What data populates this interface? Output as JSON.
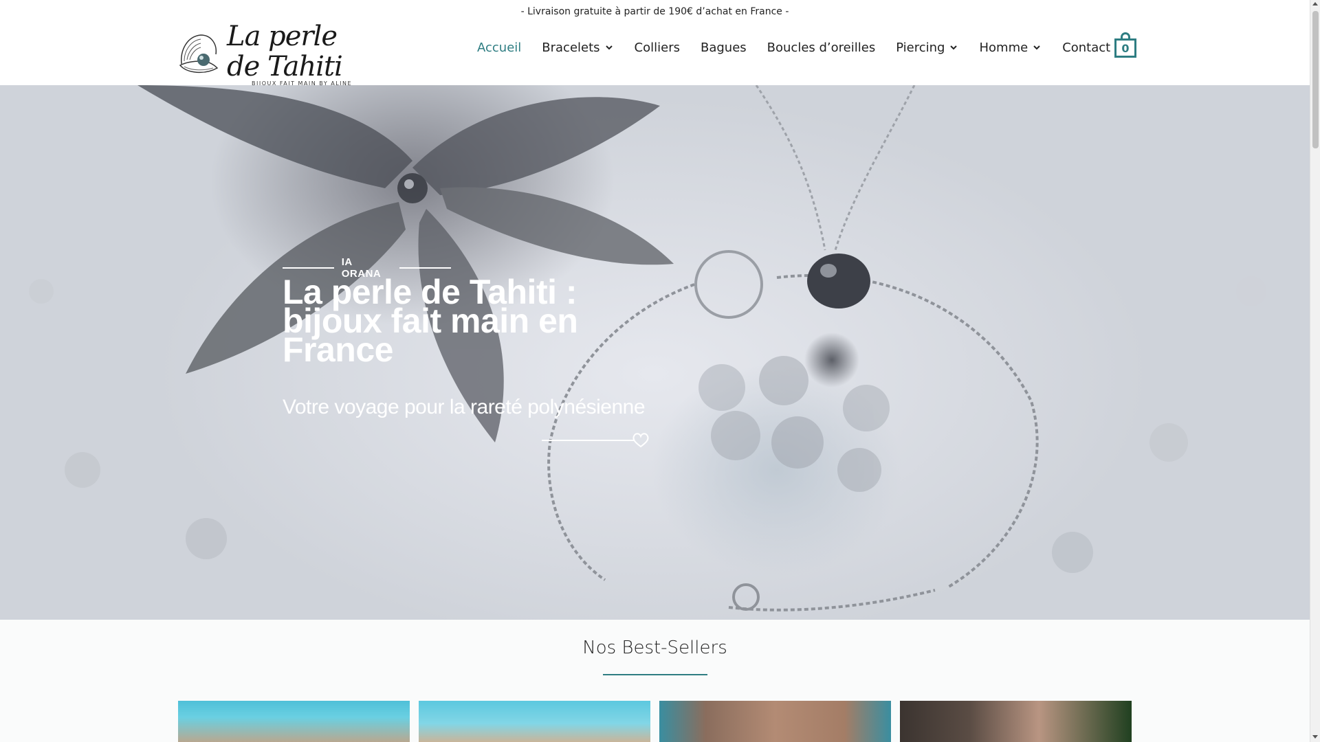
{
  "topbar": {
    "text": "- Livraison gratuite à partir de 190€ d’achat en France -"
  },
  "logo": {
    "title": "La perle de Tahiti",
    "subtitle": "BIJOUX FAIT MAIN BY ALINE",
    "icon": "pearl-shell-icon"
  },
  "nav": {
    "items": [
      {
        "label": "Accueil",
        "active": true,
        "has_dropdown": false
      },
      {
        "label": "Bracelets",
        "active": false,
        "has_dropdown": true
      },
      {
        "label": "Colliers",
        "active": false,
        "has_dropdown": false
      },
      {
        "label": "Bagues",
        "active": false,
        "has_dropdown": false
      },
      {
        "label": "Boucles d’oreilles",
        "active": false,
        "has_dropdown": false
      },
      {
        "label": "Piercing",
        "active": false,
        "has_dropdown": true
      },
      {
        "label": "Homme",
        "active": false,
        "has_dropdown": true
      },
      {
        "label": "Contact",
        "active": false,
        "has_dropdown": false
      }
    ],
    "cart_count": "0",
    "cart_icon": "shopping-bag-icon"
  },
  "hero": {
    "eyebrow": "IA ORANA",
    "title_line1": "La perle de Tahiti :",
    "title_line2": "bijoux fait main en",
    "title_line3": "France",
    "subtitle": "Votre voyage pour la rareté polynésienne",
    "deco_icon": "heart-icon"
  },
  "best_sellers": {
    "title": "Nos Best-Sellers"
  },
  "colors": {
    "accent": "#2e7d82",
    "text": "#222222",
    "background": "#ffffff"
  }
}
